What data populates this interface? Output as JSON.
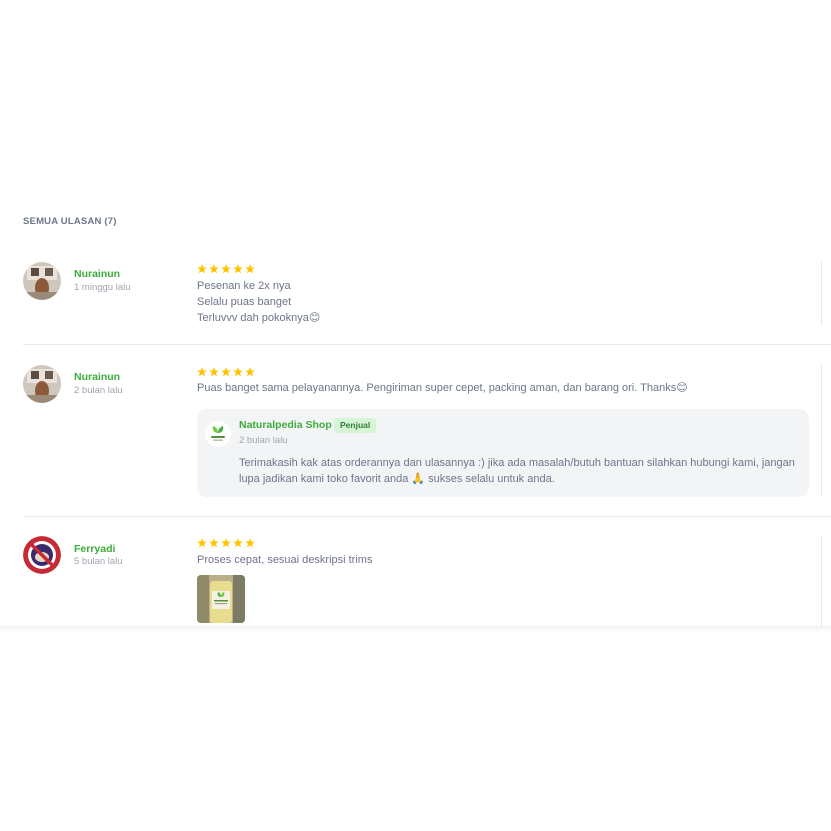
{
  "section": {
    "title": "SEMUA ULASAN (7)"
  },
  "reviews": [
    {
      "user": "Nurainun",
      "time": "1 minggu lalu",
      "rating": 5,
      "text": "Pesenan ke 2x nya\nSelalu puas banget\nTerluvvv dah pokoknya😊"
    },
    {
      "user": "Nurainun",
      "time": "2 bulan lalu",
      "rating": 5,
      "text": "Puas banget sama pelayanannya. Pengiriman super cepet, packing aman, dan barang ori. Thanks😊",
      "reply": {
        "seller": "Naturalpedia Shop",
        "badge": "Penjual",
        "time": "2 bulan lalu",
        "text": "Terimakasih kak atas orderannya dan ulasannya :) jika ada masalah/butuh bantuan silahkan hubungi kami, jangan lupa jadikan kami toko favorit anda 🙏 sukses selalu untuk anda."
      }
    },
    {
      "user": "Ferryadi",
      "time": "5 bulan lalu",
      "rating": 5,
      "text": "Proses cepat, sesuai deskripsi trims"
    }
  ],
  "colors": {
    "accent": "#3bae3c",
    "star": "#ffc400",
    "text": "#6d7588",
    "muted": "#9fa6b0"
  },
  "icons": {
    "star": "star-icon",
    "seller_logo": "leaf-logo-icon"
  }
}
